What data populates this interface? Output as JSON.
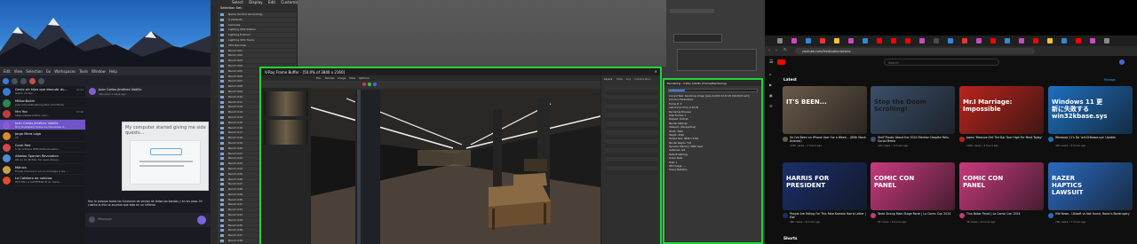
{
  "telegram": {
    "taskbar": [
      "Edit",
      "View",
      "Selection",
      "Go",
      "Workspaces",
      "Tools",
      "Window",
      "Help"
    ],
    "chats": [
      {
        "name": "Genio sin hijos que descubr du...",
        "preview": "Genio un hijo...",
        "time": "21:12",
        "color": "#3a7bd5"
      },
      {
        "name": "MillionBullet",
        "preview": "Juan Groundbreaking Rick and Morty",
        "time": "",
        "color": "#2c8a4b"
      },
      {
        "name": "Mrs Yoo",
        "preview": "https://www.adobe.com/...",
        "time": "17:10",
        "color": "#c23c3c"
      },
      {
        "name": "Juan Carlos Jiménez Vadillo",
        "preview": "Hoy le preparo todos los funciones d...",
        "time": "",
        "color": "#8a5bd1",
        "active": true
      },
      {
        "name": "Jorge Mera Lago",
        "preview": "ok",
        "time": "",
        "color": "#d98a2b"
      },
      {
        "name": "Coral Red",
        "preview": "5 de octubre #PhotoDuoCreator...",
        "time": "",
        "color": "#d04848"
      },
      {
        "name": "Albeloo Spanish Revolution",
        "preview": "Oh no Co McMsc Sin eeso Ahora...",
        "time": "",
        "color": "#4a8fd6"
      },
      {
        "name": "Mónica",
        "preview": "Ernesl mencionó en un mensaje a las...",
        "time": "",
        "color": "#c8a23a"
      },
      {
        "name": "La Cafetera de noticias",
        "preview": "HOY EN LA CAFETERA El ex minis...",
        "time": "",
        "color": "#e04a2a"
      }
    ],
    "chat_header": {
      "name": "Juan Carlos Jiménez Vadillo",
      "status": "last seen 1 days ago"
    },
    "bubble_text": "My computer started giving me side quests...",
    "message_text": "Hoy le preparo todos los funciones de ventas de todas las bandas y en los paso. En cuanto la mía se acuesto que esto en un infierno",
    "compose_placeholder": "Message"
  },
  "max": {
    "menus": [
      "Select",
      "Display",
      "Edit",
      "Customize"
    ],
    "explorer_title": "Selection Set:",
    "explorer_rows": [
      "Name (Sorted Ascending)",
      "0 (default)",
      "Cameras",
      "Lighting VDS Station",
      "Lighting Exterior",
      "Lighting VDS Trains",
      "VDS Benches",
      "Bench 001",
      "Bench 002",
      "Bench 003",
      "Bench 004",
      "Bench 005",
      "Bench 006",
      "Bench 007",
      "Bench 008",
      "Bench 009",
      "Bench 010",
      "Bench 011",
      "Bench 012",
      "Bench 013",
      "Bench 014",
      "Bench 015",
      "Bench 016",
      "Bench 017",
      "Bench 018",
      "Bench 019",
      "Bench 020",
      "Bench 021",
      "Bench 022",
      "Bench 023",
      "Bench 024",
      "Bench 025",
      "Bench 026",
      "Bench 027",
      "Bench 028",
      "Bench 029",
      "Bench 030",
      "Bench 031",
      "Bench 032",
      "Bench 033",
      "Bench 034",
      "Bench 035",
      "Bench 036",
      "Bench 037",
      "Bench 038",
      "Bench 039",
      "VDS Beat Hier"
    ],
    "vfb_title": "V-Ray Frame Buffer - [50.0% of 3840 x 2160]",
    "vfb_menus": [
      "File",
      "Render",
      "Image",
      "View",
      "Options"
    ],
    "layers_tabs": [
      "Layers",
      "Stats",
      "Log",
      "Collaboration"
    ],
    "stats_title": "Rendering - V-Ray Subdiv (Frame/Rendering)",
    "stats_rows": [
      "Current Task:  Rendering image (pass 41/100 32:15:45 [00:00:23 est])",
      "Common Parameters",
      "Frame #:  0",
      "Last Frame Time:  0:10:39",
      "Rendering Progress",
      "Total Frames:  1",
      "Elapsed:  0:00:00",
      "Render Settings",
      "Viewport: [Perspective]",
      "Width: 3840",
      "Height: 2160",
      "Output Size: 3840 x 2160",
      "Render Region: Full",
      "Dynamic Memory: 3840 Used",
      "Instances: 0/3",
      "Default Settings",
      "Scene Stats",
      "Total: 1",
      "GPU Usage: ...",
      "Scene Statistics"
    ]
  },
  "youtube": {
    "url": "youtube.com/feed/subscriptions",
    "search_placeholder": "Search",
    "section_latest": "Latest",
    "manage_label": "Manage",
    "section_shorts": "Shorts",
    "videos": [
      {
        "title": "So I've Been an iPhone User For a Week... (With Stock Android)",
        "meta": "124K views • 2 hours ago",
        "thumb_text": "IT'S BEEN...",
        "bg": "#6a5a4a",
        "fg": "#ffffff"
      },
      {
        "title": "Stuff Plastic About the 2024 Election Despite Polls, Social Media",
        "meta": "14K views • 3 hours ago",
        "thumb_text": "Stop the Doom Scrolling!",
        "bg": "#3a4f6a",
        "fg": "#1a1a1a"
      },
      {
        "title": "Japan 'Massive Get The Bar Tour High For Most Today'",
        "meta": "126K views • 4 hours ago",
        "thumb_text": "Mr.I Marriage: Impossible",
        "bg": "#b8241c",
        "fg": "#ffffff"
      },
      {
        "title": "Windows 11's Do 'win32kbase.sys' Update",
        "meta": "43K views • 5 hours ago",
        "thumb_text": "Windows 11 更新に失敗する win32kbase.sys",
        "bg": "#1e6fbf",
        "fg": "#ffffff"
      },
      {
        "title": "People Are Falling For This Fake Kamala Harris Letter | DW",
        "meta": "46K views • 6 hours ago",
        "thumb_text": "HARRIS FOR PRESIDENT",
        "bg": "#1a2f6a",
        "fg": "#ffffff"
      },
      {
        "title": "Taste Strong Main Stage Panel | La Comic Con 2024",
        "meta": "5K views • 6 hours ago",
        "thumb_text": "COMIC CON PANEL",
        "bg": "#c83a7c",
        "fg": "#ffffff"
      },
      {
        "title": "Tina Baker Panel | La Comic Con 2024",
        "meta": "3K views • 6 hours ago",
        "thumb_text": "COMIC CON PANEL",
        "bg": "#c83a7c",
        "fg": "#ffffff"
      },
      {
        "title": "HW News - Ubisoft vs Not found, Razer's Bankruptcy",
        "meta": "76K views • 7 hours ago",
        "thumb_text": "RAZER HAPTICS LAWSUIT",
        "bg": "#2a6ac0",
        "fg": "#ffffff"
      }
    ]
  },
  "colors": {
    "vfb_border": "#22d33a",
    "tg_accent": "#6f55c8",
    "yt_bg": "#0f0f0f"
  }
}
